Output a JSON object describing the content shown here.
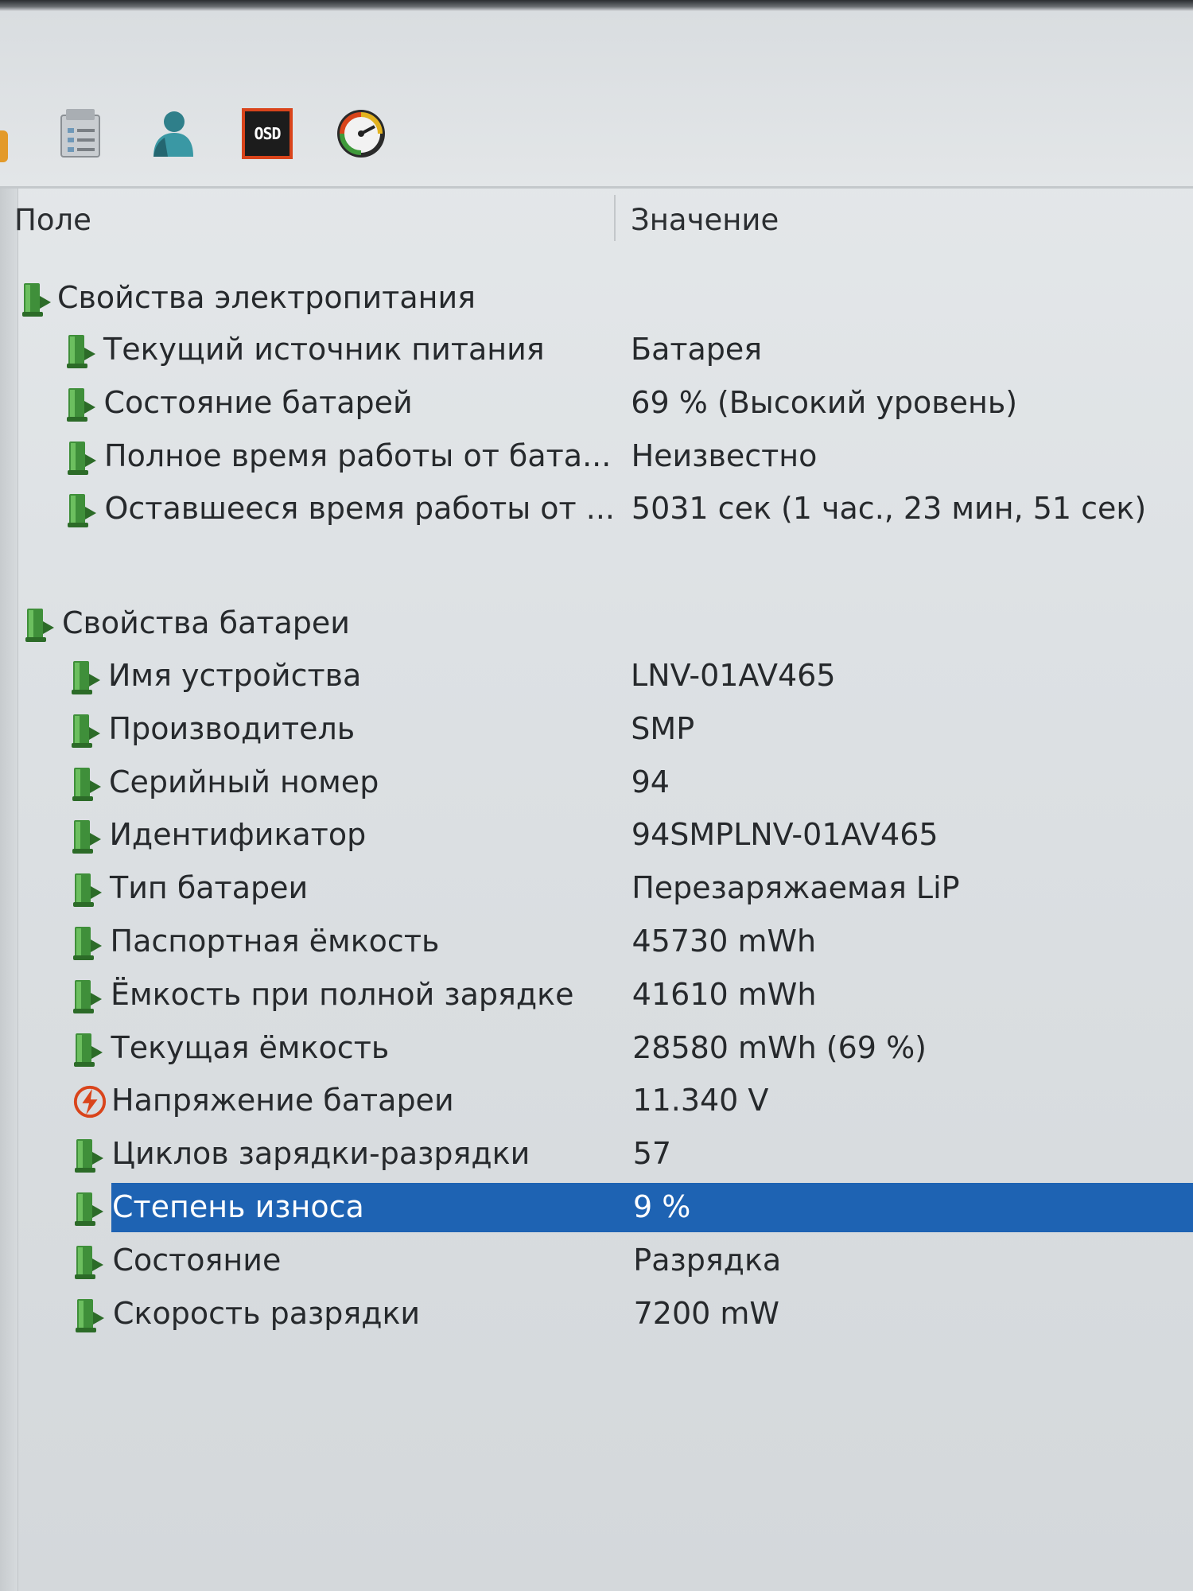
{
  "toolbar": {
    "icons": [
      "task-list-icon",
      "user-icon",
      "osd-icon",
      "gauge-icon"
    ],
    "osd_label": "OSD"
  },
  "columns": {
    "field": "Поле",
    "value": "Значение"
  },
  "groups": [
    {
      "title": "Свойства электропитания",
      "rows": [
        {
          "field": "Текущий источник питания",
          "value": "Батарея",
          "icon": "battery-icon"
        },
        {
          "field": "Состояние батарей",
          "value": "69 % (Высокий уровень)",
          "icon": "battery-icon"
        },
        {
          "field": "Полное время работы от бата...",
          "value": "Неизвестно",
          "icon": "battery-icon"
        },
        {
          "field": "Оставшееся время работы от ...",
          "value": "5031 сек (1 час., 23 мин, 51 сек)",
          "icon": "battery-icon"
        }
      ]
    },
    {
      "title": "Свойства батареи",
      "rows": [
        {
          "field": "Имя устройства",
          "value": "LNV-01AV465",
          "icon": "battery-icon"
        },
        {
          "field": "Производитель",
          "value": "SMP",
          "icon": "battery-icon"
        },
        {
          "field": "Серийный номер",
          "value": "94",
          "icon": "battery-icon"
        },
        {
          "field": "Идентификатор",
          "value": "94SMPLNV-01AV465",
          "icon": "battery-icon"
        },
        {
          "field": "Тип батареи",
          "value": "Перезаряжаемая LiP",
          "icon": "battery-icon"
        },
        {
          "field": "Паспортная ёмкость",
          "value": "45730 mWh",
          "icon": "battery-icon"
        },
        {
          "field": "Ёмкость при полной зарядке",
          "value": "41610 mWh",
          "icon": "battery-icon"
        },
        {
          "field": "Текущая ёмкость",
          "value": "28580 mWh  (69 %)",
          "icon": "battery-icon"
        },
        {
          "field": "Напряжение батареи",
          "value": "11.340 V",
          "icon": "voltage-icon"
        },
        {
          "field": "Циклов зарядки-разрядки",
          "value": "57",
          "icon": "battery-icon"
        },
        {
          "field": "Степень износа",
          "value": "9 %",
          "icon": "battery-icon",
          "selected": true
        },
        {
          "field": "Состояние",
          "value": "Разрядка",
          "icon": "battery-icon"
        },
        {
          "field": "Скорость разрядки",
          "value": "7200 mW",
          "icon": "battery-icon"
        }
      ]
    }
  ],
  "colors": {
    "selection": "#1e63b3",
    "battery_green": "#3f8f3a",
    "voltage_red": "#d9441b"
  }
}
